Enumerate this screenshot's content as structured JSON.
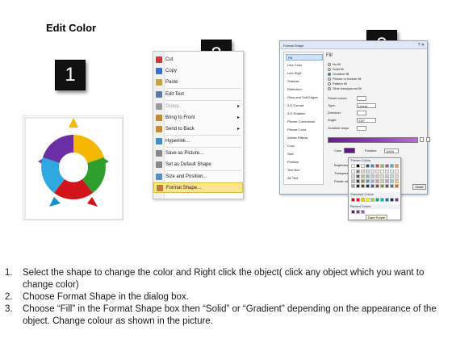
{
  "title": "Edit Color",
  "badges": [
    "1",
    "2",
    "3"
  ],
  "context_menu": {
    "items": [
      {
        "label": "Cut",
        "disabled": false,
        "submenu": false
      },
      {
        "label": "Copy",
        "disabled": false,
        "submenu": false
      },
      {
        "label": "Paste",
        "disabled": false,
        "submenu": false
      },
      {
        "label": "Edit Text",
        "disabled": false,
        "submenu": false
      },
      {
        "label": "Group",
        "disabled": true,
        "submenu": true
      },
      {
        "label": "Bring to Front",
        "disabled": false,
        "submenu": true
      },
      {
        "label": "Send to Back",
        "disabled": false,
        "submenu": true
      },
      {
        "label": "Hyperlink...",
        "disabled": false,
        "submenu": false
      },
      {
        "label": "Save as Picture...",
        "disabled": false,
        "submenu": false
      },
      {
        "label": "Set as Default Shape",
        "disabled": false,
        "submenu": false
      },
      {
        "label": "Size and Position...",
        "disabled": false,
        "submenu": false
      },
      {
        "label": "Format Shape...",
        "disabled": false,
        "submenu": false,
        "highlighted": true
      }
    ]
  },
  "format_dialog": {
    "title": "Format Shape",
    "nav": [
      "Fill",
      "Line Color",
      "Line Style",
      "Shadow",
      "Reflection",
      "Glow and Soft Edges",
      "3-D Format",
      "3-D Rotation",
      "Picture Corrections",
      "Picture Color",
      "Artistic Effects",
      "Crop",
      "Size",
      "Position",
      "Text Box",
      "Alt Text"
    ],
    "section": "Fill",
    "fill_options": [
      "No fill",
      "Solid fill",
      "Gradient fill",
      "Picture or texture fill",
      "Pattern fill",
      "Slide background fill"
    ],
    "fields": {
      "preset_colors": "Preset colors:",
      "type_label": "Type:",
      "type_value": "Linear",
      "direction_label": "Direction:",
      "angle_label": "Angle:",
      "angle_value": "130°",
      "gradient_stops": "Gradient stops",
      "color_label": "Color",
      "position_label": "Position:",
      "position_value": "100%",
      "brightness_label": "Brightness:",
      "transparency_label": "Transparency:",
      "rotate_label": "Rotate with shape"
    },
    "close_label": "Close"
  },
  "palette": {
    "theme_colors": "Theme Colors",
    "standard_colors": "Standard Colors",
    "recent_colors": "Recent Colors",
    "more_colors": "More Colors...",
    "tooltip": "Dark Purple"
  },
  "colors": {
    "wheel": [
      "#f5b800",
      "#2e9e2c",
      "#d1141a",
      "#2fa8e0",
      "#6a2fa3"
    ],
    "wheel_triangles": [
      "#f5b800",
      "#2e9e2c",
      "#d1141a",
      "#1a8fcc",
      "#7b3fb3"
    ]
  },
  "instructions": [
    {
      "num": "1.",
      "text": "Select the shape to change the color and Right click the object( click any object which you want to change color)"
    },
    {
      "num": "2.",
      "text": "Choose Format Shape in the dialog box."
    },
    {
      "num": "3.",
      "text": "Choose “Fill” in the Format Shape box then “Solid” or “Gradient” depending on the appearance of the object. Change colour as shown in the picture."
    }
  ]
}
